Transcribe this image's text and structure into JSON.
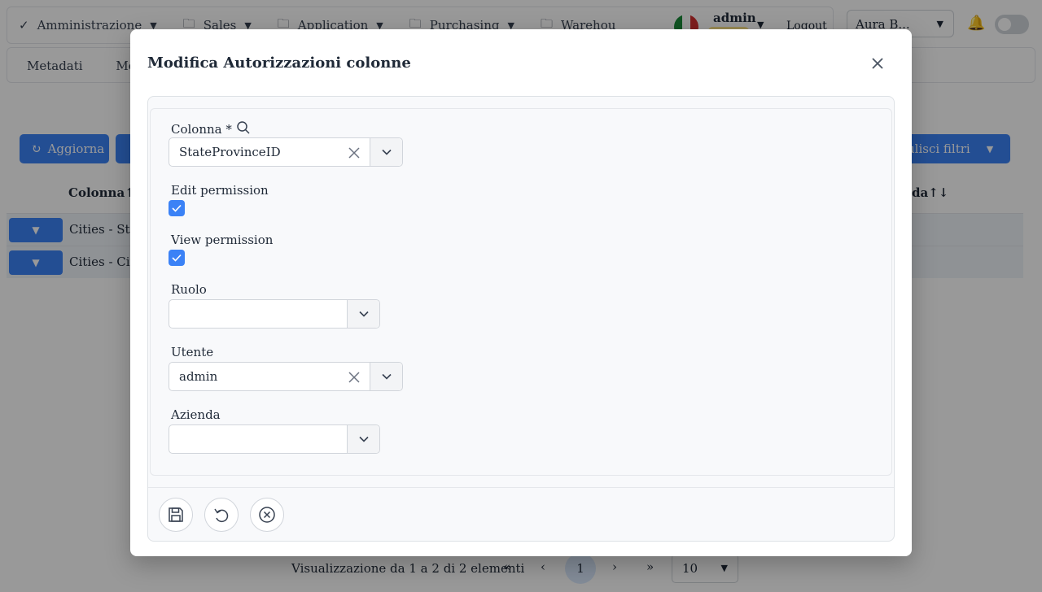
{
  "topbar": {
    "menu": [
      "Amministrazione",
      "Sales",
      "Application",
      "Purchasing",
      "Warehou"
    ],
    "user": "admin",
    "logout": "Logout",
    "company": "Aura B..."
  },
  "subbar": {
    "tabs": [
      "Metadati",
      "Meta"
    ]
  },
  "toolbar": {
    "refresh_label": "Aggiorna",
    "clear_filters_label": "ulisci filtri"
  },
  "table": {
    "header_column": "Colonna",
    "header_right": "da",
    "rows": [
      "Cities - Stat",
      "Cities - City"
    ]
  },
  "pagination": {
    "summary": "Visualizzazione da 1 a 2 di 2 elementi",
    "current_page": "1",
    "page_size": "10"
  },
  "modal": {
    "title": "Modifica Autorizzazioni colonne",
    "fields": {
      "colonna": {
        "label": "Colonna *",
        "value": "StateProvinceID"
      },
      "edit_permission": {
        "label": "Edit permission",
        "checked": true
      },
      "view_permission": {
        "label": "View permission",
        "checked": true
      },
      "ruolo": {
        "label": "Ruolo",
        "value": ""
      },
      "utente": {
        "label": "Utente",
        "value": "admin"
      },
      "azienda": {
        "label": "Azienda",
        "value": ""
      }
    }
  },
  "colors": {
    "primary": "#3b82f6",
    "overlay": "rgba(0,0,0,0.4)"
  }
}
